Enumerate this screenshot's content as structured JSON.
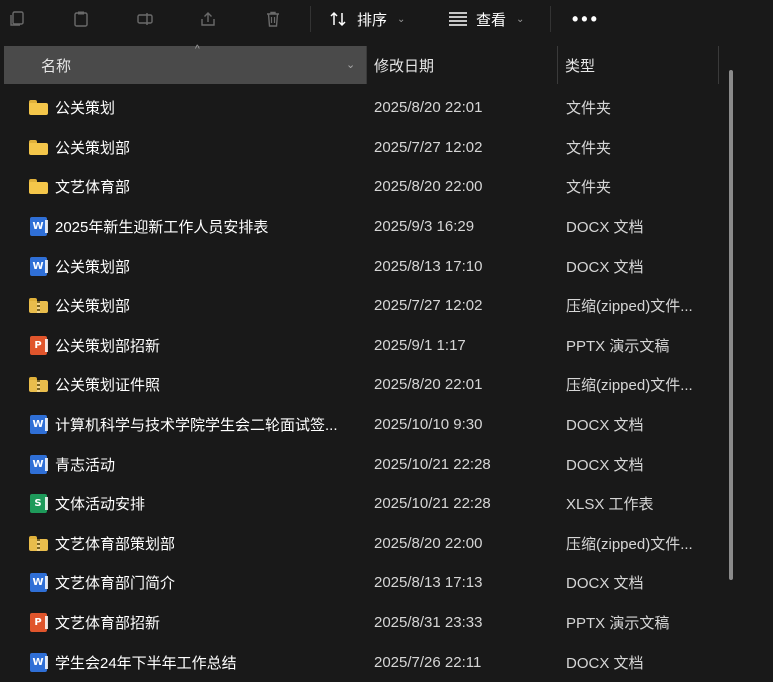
{
  "toolbar": {
    "sort_label": "排序",
    "view_label": "查看",
    "icons": [
      "copy-icon",
      "paste-icon",
      "rename-icon",
      "share-icon",
      "delete-icon",
      "sort-icon",
      "view-icon",
      "more-icon"
    ]
  },
  "columns": {
    "name": "名称",
    "date": "修改日期",
    "type": "类型"
  },
  "files": [
    {
      "name": "公关策划",
      "date": "2025/8/20 22:01",
      "type": "文件夹",
      "icon": "folder"
    },
    {
      "name": "公关策划部",
      "date": "2025/7/27 12:02",
      "type": "文件夹",
      "icon": "folder"
    },
    {
      "name": "文艺体育部",
      "date": "2025/8/20 22:00",
      "type": "文件夹",
      "icon": "folder"
    },
    {
      "name": "2025年新生迎新工作人员安排表",
      "date": "2025/9/3 16:29",
      "type": "DOCX 文档",
      "icon": "word"
    },
    {
      "name": "公关策划部",
      "date": "2025/8/13 17:10",
      "type": "DOCX 文档",
      "icon": "word"
    },
    {
      "name": "公关策划部",
      "date": "2025/7/27 12:02",
      "type": "压缩(zipped)文件...",
      "icon": "zip"
    },
    {
      "name": "公关策划部招新",
      "date": "2025/9/1 1:17",
      "type": "PPTX 演示文稿",
      "icon": "ppt"
    },
    {
      "name": "公关策划证件照",
      "date": "2025/8/20 22:01",
      "type": "压缩(zipped)文件...",
      "icon": "zip"
    },
    {
      "name": "计算机科学与技术学院学生会二轮面试签...",
      "date": "2025/10/10 9:30",
      "type": "DOCX 文档",
      "icon": "word"
    },
    {
      "name": "青志活动",
      "date": "2025/10/21 22:28",
      "type": "DOCX 文档",
      "icon": "word"
    },
    {
      "name": "文体活动安排",
      "date": "2025/10/21 22:28",
      "type": "XLSX 工作表",
      "icon": "xlsx"
    },
    {
      "name": "文艺体育部策划部",
      "date": "2025/8/20 22:00",
      "type": "压缩(zipped)文件...",
      "icon": "zip"
    },
    {
      "name": "文艺体育部门简介",
      "date": "2025/8/13 17:13",
      "type": "DOCX 文档",
      "icon": "word"
    },
    {
      "name": "文艺体育部招新",
      "date": "2025/8/31 23:33",
      "type": "PPTX 演示文稿",
      "icon": "ppt"
    },
    {
      "name": "学生会24年下半年工作总结",
      "date": "2025/7/26 22:11",
      "type": "DOCX 文档",
      "icon": "word"
    }
  ]
}
